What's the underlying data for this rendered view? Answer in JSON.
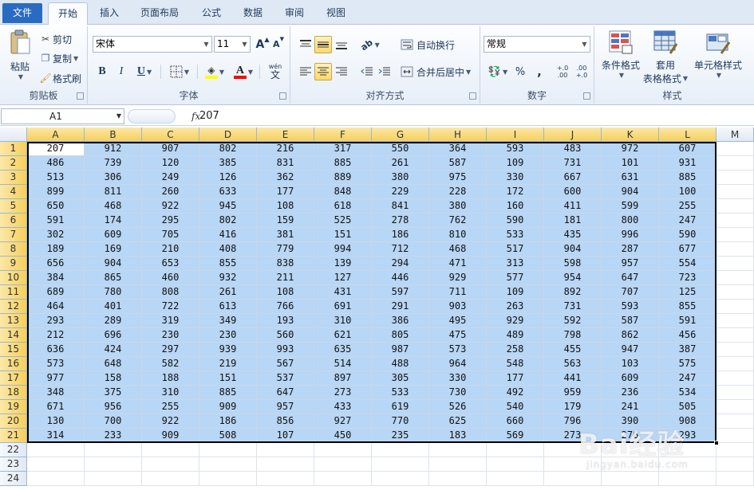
{
  "tabs": [
    {
      "label": "文件"
    },
    {
      "label": "开始"
    },
    {
      "label": "插入"
    },
    {
      "label": "页面布局"
    },
    {
      "label": "公式"
    },
    {
      "label": "数据"
    },
    {
      "label": "审阅"
    },
    {
      "label": "视图"
    }
  ],
  "ribbon": {
    "clipboard": {
      "group_label": "剪贴板",
      "paste": "粘贴",
      "cut": "剪切",
      "copy": "复制",
      "format_painter": "格式刷"
    },
    "font": {
      "group_label": "字体",
      "font_name": "宋体",
      "font_size": "11",
      "grow": "A",
      "shrink": "A",
      "bold": "B",
      "italic": "I",
      "underline": "U",
      "fill_color": "#ffff00",
      "font_color": "#ff0000",
      "phonetic": "wén"
    },
    "alignment": {
      "group_label": "对齐方式",
      "wrap_text": "自动换行",
      "merge_center": "合并后居中"
    },
    "number": {
      "group_label": "数字",
      "format": "常规",
      "percent": "%",
      "comma": ",",
      "inc_decimal": "+.0 .00",
      "dec_decimal": ".00 +.0"
    },
    "styles": {
      "group_label": "样式",
      "conditional_format": "条件格式",
      "format_as_table_1": "套用",
      "format_as_table_2": "表格格式",
      "cell_styles": "单元格样式"
    }
  },
  "formula_bar": {
    "name_box": "A1",
    "fx": "fx",
    "value": "207"
  },
  "columns": [
    "A",
    "B",
    "C",
    "D",
    "E",
    "F",
    "G",
    "H",
    "I",
    "J",
    "K",
    "L",
    "M"
  ],
  "rows": [
    [
      207,
      912,
      907,
      802,
      216,
      317,
      550,
      364,
      593,
      483,
      972,
      607
    ],
    [
      486,
      739,
      120,
      385,
      831,
      885,
      261,
      587,
      109,
      731,
      101,
      931
    ],
    [
      513,
      306,
      249,
      126,
      362,
      889,
      380,
      975,
      330,
      667,
      631,
      885
    ],
    [
      899,
      811,
      260,
      633,
      177,
      848,
      229,
      228,
      172,
      600,
      904,
      100
    ],
    [
      650,
      468,
      922,
      945,
      108,
      618,
      841,
      380,
      160,
      411,
      599,
      255
    ],
    [
      591,
      174,
      295,
      802,
      159,
      525,
      278,
      762,
      590,
      181,
      800,
      247
    ],
    [
      302,
      609,
      705,
      416,
      381,
      151,
      186,
      810,
      533,
      435,
      996,
      590
    ],
    [
      189,
      169,
      210,
      408,
      779,
      994,
      712,
      468,
      517,
      904,
      287,
      677
    ],
    [
      656,
      904,
      653,
      855,
      838,
      139,
      294,
      471,
      313,
      598,
      957,
      554
    ],
    [
      384,
      865,
      460,
      932,
      211,
      127,
      446,
      929,
      577,
      954,
      647,
      723
    ],
    [
      689,
      780,
      808,
      261,
      108,
      431,
      597,
      711,
      109,
      892,
      707,
      125
    ],
    [
      464,
      401,
      722,
      613,
      766,
      691,
      291,
      903,
      263,
      731,
      593,
      855
    ],
    [
      293,
      289,
      319,
      349,
      193,
      310,
      386,
      495,
      929,
      592,
      587,
      591
    ],
    [
      212,
      696,
      230,
      230,
      560,
      621,
      805,
      475,
      489,
      798,
      862,
      456
    ],
    [
      636,
      424,
      297,
      939,
      993,
      635,
      987,
      573,
      258,
      455,
      947,
      387
    ],
    [
      573,
      648,
      582,
      219,
      567,
      514,
      488,
      964,
      548,
      563,
      103,
      575
    ],
    [
      977,
      158,
      188,
      151,
      537,
      897,
      305,
      330,
      177,
      441,
      609,
      247
    ],
    [
      348,
      375,
      310,
      885,
      647,
      273,
      533,
      730,
      492,
      959,
      236,
      534
    ],
    [
      671,
      956,
      255,
      909,
      957,
      433,
      619,
      526,
      540,
      179,
      241,
      505
    ],
    [
      130,
      700,
      922,
      186,
      856,
      927,
      770,
      625,
      660,
      796,
      390,
      908
    ],
    [
      314,
      233,
      909,
      508,
      107,
      450,
      235,
      183,
      569,
      273,
      276,
      293
    ]
  ],
  "empty_rows": [
    "22",
    "23",
    "24"
  ],
  "colors": {
    "selection": "#b8d6f5",
    "header_highlight": "#f6cf5c",
    "file_tab": "#2a6bc2"
  },
  "watermark": {
    "brand": "Bai经验",
    "url": "jingyan.baidu.com"
  }
}
